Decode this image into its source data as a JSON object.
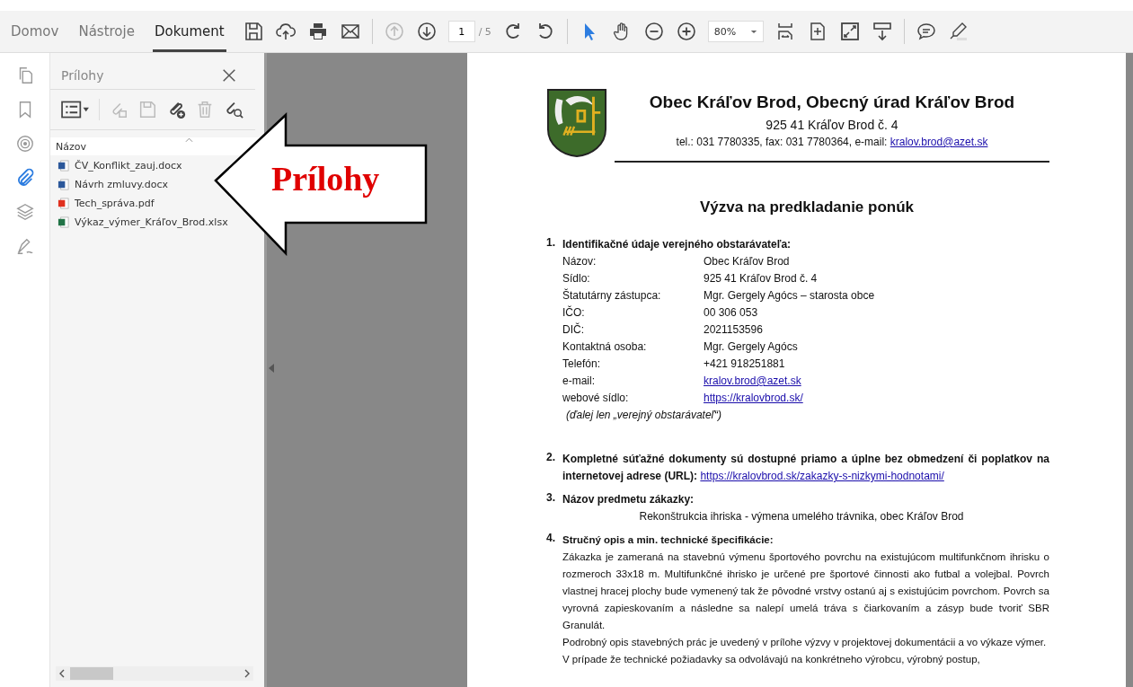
{
  "toolbar": {
    "tabs": [
      {
        "label": "Domov",
        "selected": false
      },
      {
        "label": "Nástroje",
        "selected": false
      },
      {
        "label": "Dokument",
        "selected": true
      }
    ],
    "page_input": "1",
    "page_total": "/ 5",
    "zoom": "80%"
  },
  "rail": [
    {
      "kind": "pages",
      "selected": false
    },
    {
      "kind": "bookmark",
      "selected": false
    },
    {
      "kind": "target",
      "selected": false
    },
    {
      "kind": "attachment",
      "selected": true
    },
    {
      "kind": "layers",
      "selected": false
    },
    {
      "kind": "signature",
      "selected": false
    }
  ],
  "attachments_panel": {
    "title": "Prílohy",
    "column": "Názov",
    "files": [
      {
        "name": "ČV_Konflikt_zauj.docx",
        "kind": "word"
      },
      {
        "name": "Návrh zmluvy.docx",
        "kind": "word"
      },
      {
        "name": "Tech_správa.pdf",
        "kind": "pdf"
      },
      {
        "name": "Výkaz_výmer_Kráľov_Brod.xlsx",
        "kind": "excel"
      }
    ]
  },
  "callout": {
    "label": "Prílohy"
  },
  "document": {
    "title": "Obec Kráľov Brod, Obecný úrad Kráľov Brod",
    "address": "925 41 Kráľov Brod č. 4",
    "contact": "tel.: 031 7780335, fax: 031 7780364, e-mail:",
    "contact_email": "kralov.brod@azet.sk",
    "heading": "Výzva na predkladanie ponúk",
    "sections": [
      {
        "number": "1.",
        "title": "Identifikačné údaje verejného obstarávateľa:",
        "fields": [
          {
            "label": "Názov:",
            "value": "Obec Kráľov Brod",
            "link": false
          },
          {
            "label": "Sídlo:",
            "value": "925 41 Kráľov Brod č. 4",
            "link": false
          },
          {
            "label": "Štatutárny zástupca:",
            "value": "Mgr. Gergely Agócs – starosta obce",
            "link": false
          },
          {
            "label": "IČO:",
            "value": "00 306 053",
            "link": false
          },
          {
            "label": "DIČ:",
            "value": "2021153596",
            "link": false
          },
          {
            "label": "Kontaktná osoba:",
            "value": "Mgr. Gergely Agócs",
            "link": false
          },
          {
            "label": "Telefón:",
            "value": "+421 918251881",
            "link": false
          },
          {
            "label": "e-mail:",
            "value": "kralov.brod@azet.sk",
            "link": true
          },
          {
            "label": "webové sídlo:",
            "value": "https://kralovbrod.sk/",
            "link": true
          }
        ],
        "note": "(ďalej len „verejný obstarávateľ“)"
      },
      {
        "number": "2.",
        "title": "Kompletné súťažné dokumenty sú dostupné priamo a úplne bez obmedzení či poplatkov na internetovej adrese (URL):",
        "link": "https://kralovbrod.sk/zakazky-s-nizkymi-hodnotami/"
      },
      {
        "number": "3.",
        "title": "Názov predmetu zákazky:",
        "centered": "Rekonštrukcia ihriska - výmena umelého trávnika, obec Kráľov Brod"
      },
      {
        "number": "4.",
        "title": "Stručný opis a min. technické špecifikácie:",
        "paragraphs": [
          "Zákazka je zameraná na stavebnú výmenu športového povrchu na existujúcom multifunkčnom ihrisku o rozmeroch 33x18 m. Multifunkčné ihrisko je určené pre športové činnosti ako futbal a volejbal. Povrch vlastnej hracej plochy bude vymenený tak že pôvodné vrstvy ostanú aj s existujúcim povrchom. Povrch sa vyrovná zapieskovaním a následne sa nalepí umelá tráva s čiarkovaním a zásyp bude tvoriť SBR Granulát.",
          "Podrobný opis stavebných prác je uvedený v prílohe výzvy v projektovej dokumentácii a vo výkaze výmer.",
          "V prípade že technické požiadavky sa odvolávajú na konkrétneho výrobcu, výrobný postup,"
        ]
      }
    ]
  }
}
